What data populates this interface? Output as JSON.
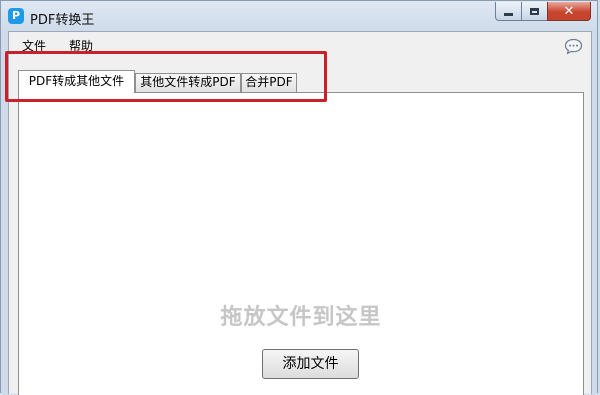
{
  "window": {
    "title": "PDF转换王",
    "logo_letter": "P",
    "logo_color": "#1f9ae8"
  },
  "caption_buttons": [
    "minimize-icon",
    "maximize-icon",
    "close-icon"
  ],
  "caption_close_glyph": "✕",
  "menu": {
    "file": "文件",
    "help": "帮助"
  },
  "toolbar": {
    "feedback_icon": "chat-bubble-icon"
  },
  "tabs": [
    {
      "label": "PDF转成其他文件",
      "active": true
    },
    {
      "label": "其他文件转成PDF",
      "active": false
    },
    {
      "label": "合并PDF",
      "active": false
    }
  ],
  "panel": {
    "drop_hint": "拖放文件到这里",
    "add_button_label": "添加文件"
  },
  "annotation": {
    "highlight_color": "#c9202a"
  }
}
